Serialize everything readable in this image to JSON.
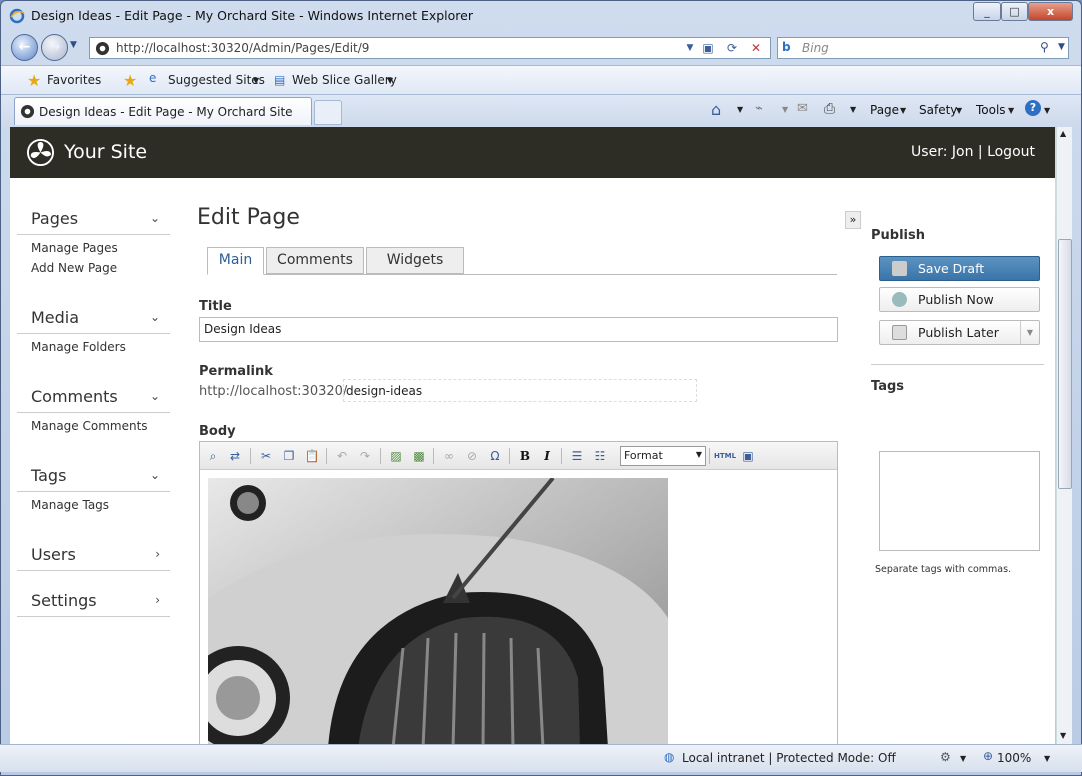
{
  "window": {
    "title": "Design Ideas - Edit Page - My Orchard Site - Windows Internet Explorer",
    "min": "_",
    "max": "□",
    "close": "x"
  },
  "address": {
    "url": "http://localhost:30320/Admin/Pages/Edit/9",
    "search_placeholder": "Bing"
  },
  "favorites": {
    "favorites": "Favorites",
    "suggested": "Suggested Sites",
    "webslice": "Web Slice Gallery"
  },
  "tab": {
    "label": "Design Ideas - Edit Page - My Orchard Site"
  },
  "commands": {
    "page": "Page",
    "safety": "Safety",
    "tools": "Tools"
  },
  "header": {
    "site": "Your Site",
    "user": "User: Jon | Logout"
  },
  "sidebar": [
    {
      "title": "Pages",
      "links": [
        "Manage Pages",
        "Add New Page"
      ],
      "chev": "⌄"
    },
    {
      "title": "Media",
      "links": [
        "Manage Folders"
      ],
      "chev": "⌄"
    },
    {
      "title": "Comments",
      "links": [
        "Manage Comments"
      ],
      "chev": "⌄"
    },
    {
      "title": "Tags",
      "links": [
        "Manage Tags"
      ],
      "chev": "⌄"
    },
    {
      "title": "Users",
      "links": [],
      "chev": "›"
    },
    {
      "title": "Settings",
      "links": [],
      "chev": "›"
    }
  ],
  "main": {
    "heading": "Edit Page",
    "tabs": [
      "Main",
      "Comments",
      "Widgets"
    ],
    "title_label": "Title",
    "title_value": "Design Ideas",
    "permalink_label": "Permalink",
    "permalink_prefix": "http://localhost:30320/",
    "permalink_slug": "design-ideas",
    "body_label": "Body",
    "format": "Format"
  },
  "publish": {
    "title": "Publish",
    "save_draft": "Save Draft",
    "publish_now": "Publish Now",
    "publish_later": "Publish Later",
    "tags_title": "Tags",
    "tags_hint": "Separate tags with commas."
  },
  "status": {
    "zone": "Local intranet | Protected Mode: Off",
    "zoom": "100%"
  }
}
